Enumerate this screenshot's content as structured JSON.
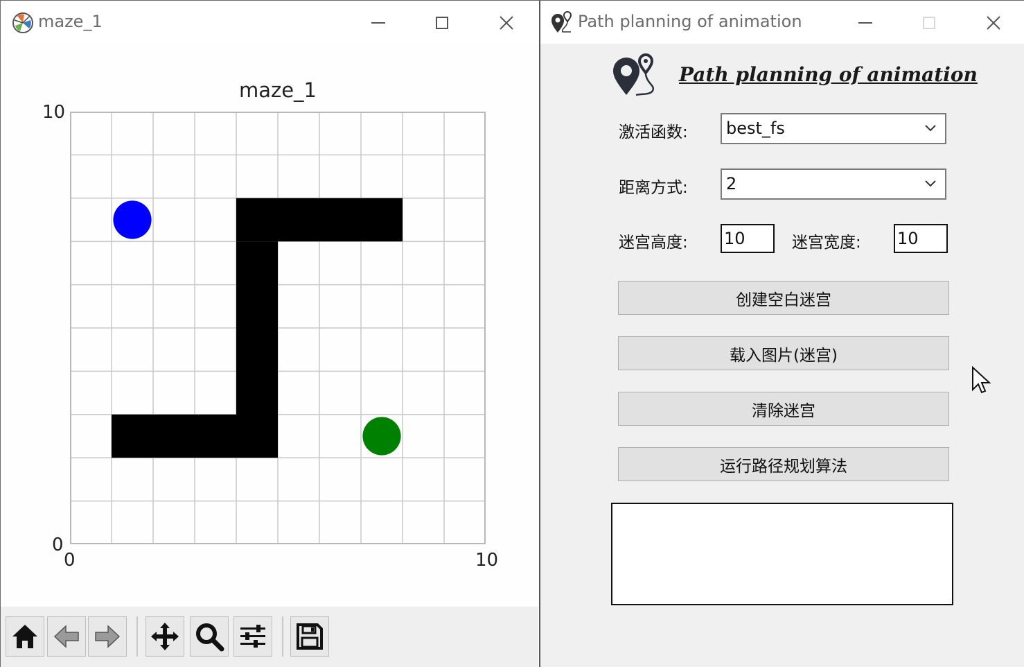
{
  "left_window": {
    "title": "maze_1",
    "plot": {
      "title": "maze_1",
      "x_tick_min": "0",
      "x_tick_max": "10",
      "y_tick_min": "0",
      "y_tick_max": "10"
    },
    "toolbar": [
      "home-icon",
      "back-arrow-icon",
      "forward-arrow-icon",
      "pan-icon",
      "zoom-icon",
      "configure-subplots-icon",
      "save-icon"
    ]
  },
  "maze": {
    "size": [
      10,
      10
    ],
    "walls": [
      {
        "x": [
          4,
          8
        ],
        "y": [
          7,
          8
        ]
      },
      {
        "x": [
          4,
          5
        ],
        "y": [
          2,
          7
        ]
      },
      {
        "x": [
          1,
          4
        ],
        "y": [
          2,
          3
        ]
      }
    ],
    "start": {
      "x": 1.5,
      "y": 7.5,
      "color": "#0000ff"
    },
    "goal": {
      "x": 7.5,
      "y": 2.5,
      "color": "#008000"
    }
  },
  "right_window": {
    "title": "Path planning of animation",
    "app_title": "Path planning of animation",
    "heuristic_label": "激活函数:",
    "heuristic_value": "best_fs",
    "distance_label": "距离方式:",
    "distance_value": "2",
    "height_label": "迷宫高度:",
    "height_value": "10",
    "width_label": "迷宫宽度:",
    "width_value": "10",
    "buttons": {
      "create_blank": "创建空白迷宫",
      "load_image": "载入图片(迷宫)",
      "clear": "清除迷宫",
      "run": "运行路径规划算法"
    }
  }
}
